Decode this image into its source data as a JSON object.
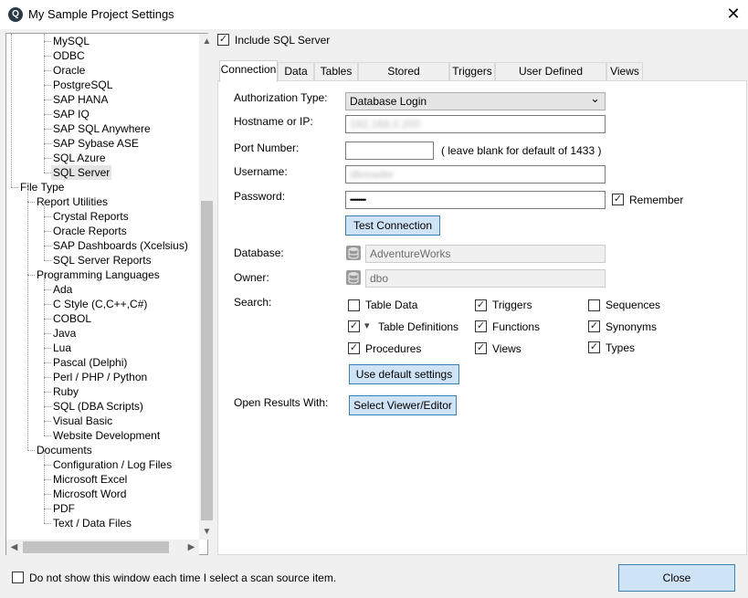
{
  "window": {
    "title": "My Sample Project Settings",
    "app_icon": "Q",
    "close_glyph": "✕"
  },
  "tree": {
    "items": [
      {
        "label": "MySQL",
        "level": 2
      },
      {
        "label": "ODBC",
        "level": 2
      },
      {
        "label": "Oracle",
        "level": 2
      },
      {
        "label": "PostgreSQL",
        "level": 2
      },
      {
        "label": "SAP HANA",
        "level": 2
      },
      {
        "label": "SAP IQ",
        "level": 2
      },
      {
        "label": "SAP SQL Anywhere",
        "level": 2
      },
      {
        "label": "SAP Sybase ASE",
        "level": 2
      },
      {
        "label": "SQL Azure",
        "level": 2
      },
      {
        "label": "SQL Server",
        "level": 2,
        "selected": true
      },
      {
        "label": "File Type",
        "level": 0
      },
      {
        "label": "Report Utilities",
        "level": 1
      },
      {
        "label": "Crystal Reports",
        "level": 2
      },
      {
        "label": "Oracle Reports",
        "level": 2
      },
      {
        "label": "SAP Dashboards (Xcelsius)",
        "level": 2
      },
      {
        "label": "SQL Server Reports",
        "level": 2
      },
      {
        "label": "Programming Languages",
        "level": 1
      },
      {
        "label": "Ada",
        "level": 2
      },
      {
        "label": "C Style (C,C++,C#)",
        "level": 2
      },
      {
        "label": "COBOL",
        "level": 2
      },
      {
        "label": "Java",
        "level": 2
      },
      {
        "label": "Lua",
        "level": 2
      },
      {
        "label": "Pascal (Delphi)",
        "level": 2
      },
      {
        "label": "Perl / PHP / Python",
        "level": 2
      },
      {
        "label": "Ruby",
        "level": 2
      },
      {
        "label": "SQL (DBA Scripts)",
        "level": 2
      },
      {
        "label": "Visual Basic",
        "level": 2
      },
      {
        "label": "Website Development",
        "level": 2
      },
      {
        "label": "Documents",
        "level": 1
      },
      {
        "label": "Configuration / Log Files",
        "level": 2
      },
      {
        "label": "Microsoft Excel",
        "level": 2
      },
      {
        "label": "Microsoft Word",
        "level": 2
      },
      {
        "label": "PDF",
        "level": 2
      },
      {
        "label": "Text / Data Files",
        "level": 2
      }
    ],
    "scroll_up": "▲",
    "scroll_down": "▼",
    "scroll_left": "◀",
    "scroll_right": "▶"
  },
  "include_sql_server": {
    "label": "Include SQL Server",
    "checked": true
  },
  "tabs": [
    "Connection",
    "Data",
    "Tables",
    "Stored Procedures",
    "Triggers",
    "User Defined Functions",
    "Views"
  ],
  "connection": {
    "auth_type_label": "Authorization Type:",
    "auth_type_value": "Database Login",
    "hostname_label": "Hostname or IP:",
    "hostname_value": "192.168.0.200",
    "port_label": "Port Number:",
    "port_value": "",
    "port_hint": "( leave blank for default of 1433 )",
    "username_label": "Username:",
    "username_value": "dbreader",
    "password_label": "Password:",
    "password_value": "••••••••",
    "remember_label": "Remember",
    "remember_checked": true,
    "test_button": "Test Connection",
    "database_label": "Database:",
    "database_value": "AdventureWorks",
    "owner_label": "Owner:",
    "owner_value": "dbo",
    "search_label": "Search:",
    "search_options": {
      "table_data": {
        "label": "Table Data",
        "checked": false
      },
      "table_definitions": {
        "label": "Table Definitions",
        "checked": true
      },
      "procedures": {
        "label": "Procedures",
        "checked": true
      },
      "triggers": {
        "label": "Triggers",
        "checked": true
      },
      "functions": {
        "label": "Functions",
        "checked": true
      },
      "views": {
        "label": "Views",
        "checked": true
      },
      "sequences": {
        "label": "Sequences",
        "checked": false
      },
      "synonyms": {
        "label": "Synonyms",
        "checked": true
      },
      "types": {
        "label": "Types",
        "checked": true
      }
    },
    "default_settings_button": "Use default settings",
    "open_results_label": "Open Results With:",
    "viewer_button": "Select Viewer/Editor"
  },
  "footer": {
    "dont_show_label": "Do not show this window each time I select a scan source item.",
    "dont_show_checked": false,
    "close_button": "Close"
  },
  "glyphs": {
    "check": "✓",
    "dropdown": "⌄",
    "filter": "▾"
  },
  "colors": {
    "accent_blue": "#cfe3f6",
    "accent_border": "#3c7fb1"
  }
}
